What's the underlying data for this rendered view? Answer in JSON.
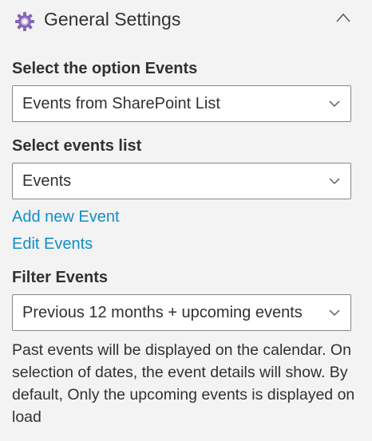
{
  "header": {
    "title": "General Settings",
    "icon": "gear-icon",
    "collapse_icon": "chevron-up-icon",
    "icon_color": "#8764b8"
  },
  "fields": {
    "event_option": {
      "label": "Select the option Events",
      "value": "Events from SharePoint List"
    },
    "events_list": {
      "label": "Select events list",
      "value": "Events"
    },
    "filter": {
      "label": "Filter Events",
      "value": "Previous 12 months + upcoming events"
    }
  },
  "links": {
    "add_event": "Add new Event",
    "edit_events": "Edit Events",
    "color": "#0f8fc9"
  },
  "help_text": "Past events will be displayed on the calendar. On selection of dates, the event details will show. By default, Only the upcoming events is displayed on load"
}
